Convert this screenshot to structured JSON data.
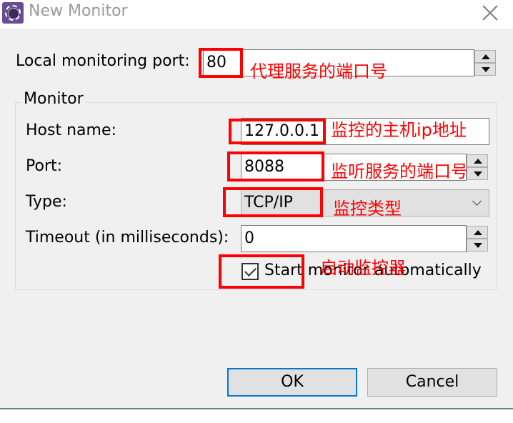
{
  "window": {
    "title": "New Monitor",
    "icon": "eclipse-gear-icon",
    "close_icon": "close-icon"
  },
  "local_port": {
    "label": "Local monitoring port:",
    "value": "80"
  },
  "monitor_group": {
    "title": "Monitor",
    "host": {
      "label": "Host name:",
      "value": "127.0.0.1"
    },
    "port": {
      "label": "Port:",
      "value": "8088"
    },
    "type": {
      "label": "Type:",
      "selected": "TCP/IP"
    },
    "timeout": {
      "label": "Timeout (in milliseconds):",
      "value": "0"
    },
    "auto_start": {
      "label": "Start monitor automatically",
      "checked": true
    }
  },
  "buttons": {
    "ok": "OK",
    "cancel": "Cancel"
  },
  "annotations": {
    "color": "#ff0000",
    "local_port_note": "代理服务的端口号",
    "host_note": "监控的主机ip地址",
    "port_note": "监听服务的端口号",
    "type_note": "监控类型",
    "auto_start_note": "启动监控器"
  },
  "colors": {
    "default_button_border": "#0078d7",
    "dialog_background": "#f0f0f0",
    "title_text": "#999999"
  }
}
